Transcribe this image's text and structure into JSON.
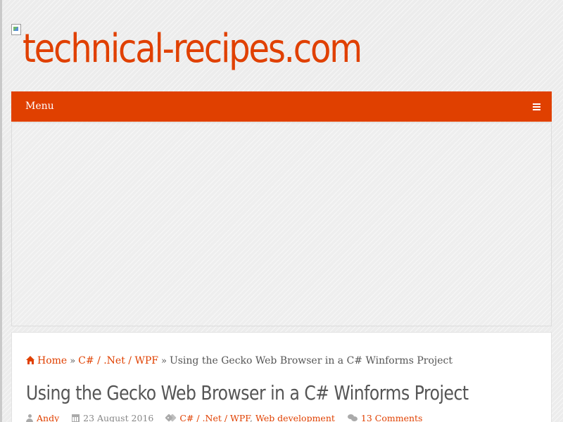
{
  "site": {
    "title": "technical-recipes.com",
    "logo_icon": "broken-image-icon"
  },
  "colors": {
    "accent": "#e04000",
    "text": "#555555",
    "meta": "#888888",
    "page_bg": "#ececec"
  },
  "menu": {
    "label": "Menu",
    "toggle_icon": "hamburger-icon"
  },
  "breadcrumb": {
    "home_icon": "home-icon",
    "home": "Home",
    "separator": "»",
    "category": "C# / .Net / WPF",
    "current": "Using the Gecko Web Browser in a C# Winforms Project"
  },
  "post": {
    "title": "Using the Gecko Web Browser in a C# Winforms Project",
    "meta": {
      "author": "Andy",
      "date": "23 August 2016",
      "category_1": "C# / .Net / WPF",
      "category_separator": ", ",
      "category_2": "Web development",
      "comments": "13 Comments",
      "icons": [
        "user-icon",
        "calendar-icon",
        "tags-icon",
        "comments-icon"
      ]
    }
  }
}
